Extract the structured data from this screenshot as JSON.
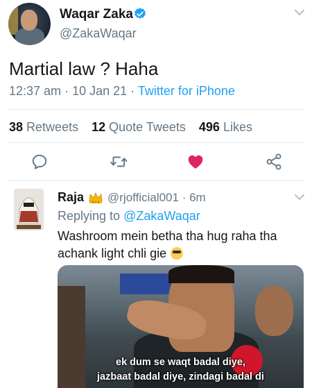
{
  "tweet": {
    "author_name": "Waqar Zaka",
    "author_handle": "@ZakaWaqar",
    "text": "Martial law ? Haha",
    "time": "12:37 am",
    "date": "10 Jan 21",
    "source": "Twitter for iPhone",
    "retweets_count": "38",
    "retweets_label": "Retweets",
    "quotes_count": "12",
    "quotes_label": "Quote Tweets",
    "likes_count": "496",
    "likes_label": "Likes"
  },
  "reply": {
    "author_name": "Raja",
    "author_handle": "@rjofficial001",
    "time": "6m",
    "replying_prefix": "Replying to",
    "replying_to": "@ZakaWaqar",
    "text": "Washroom mein betha tha hug raha tha achank light chli gie",
    "media": {
      "subtitle_line1": "ek dum se waqt badal diye,",
      "subtitle_line2": "jazbaat badal diye, zindagi badal di"
    }
  },
  "colors": {
    "accent": "#1da1f2",
    "secondary_text": "#657786",
    "like": "#e0245e"
  }
}
